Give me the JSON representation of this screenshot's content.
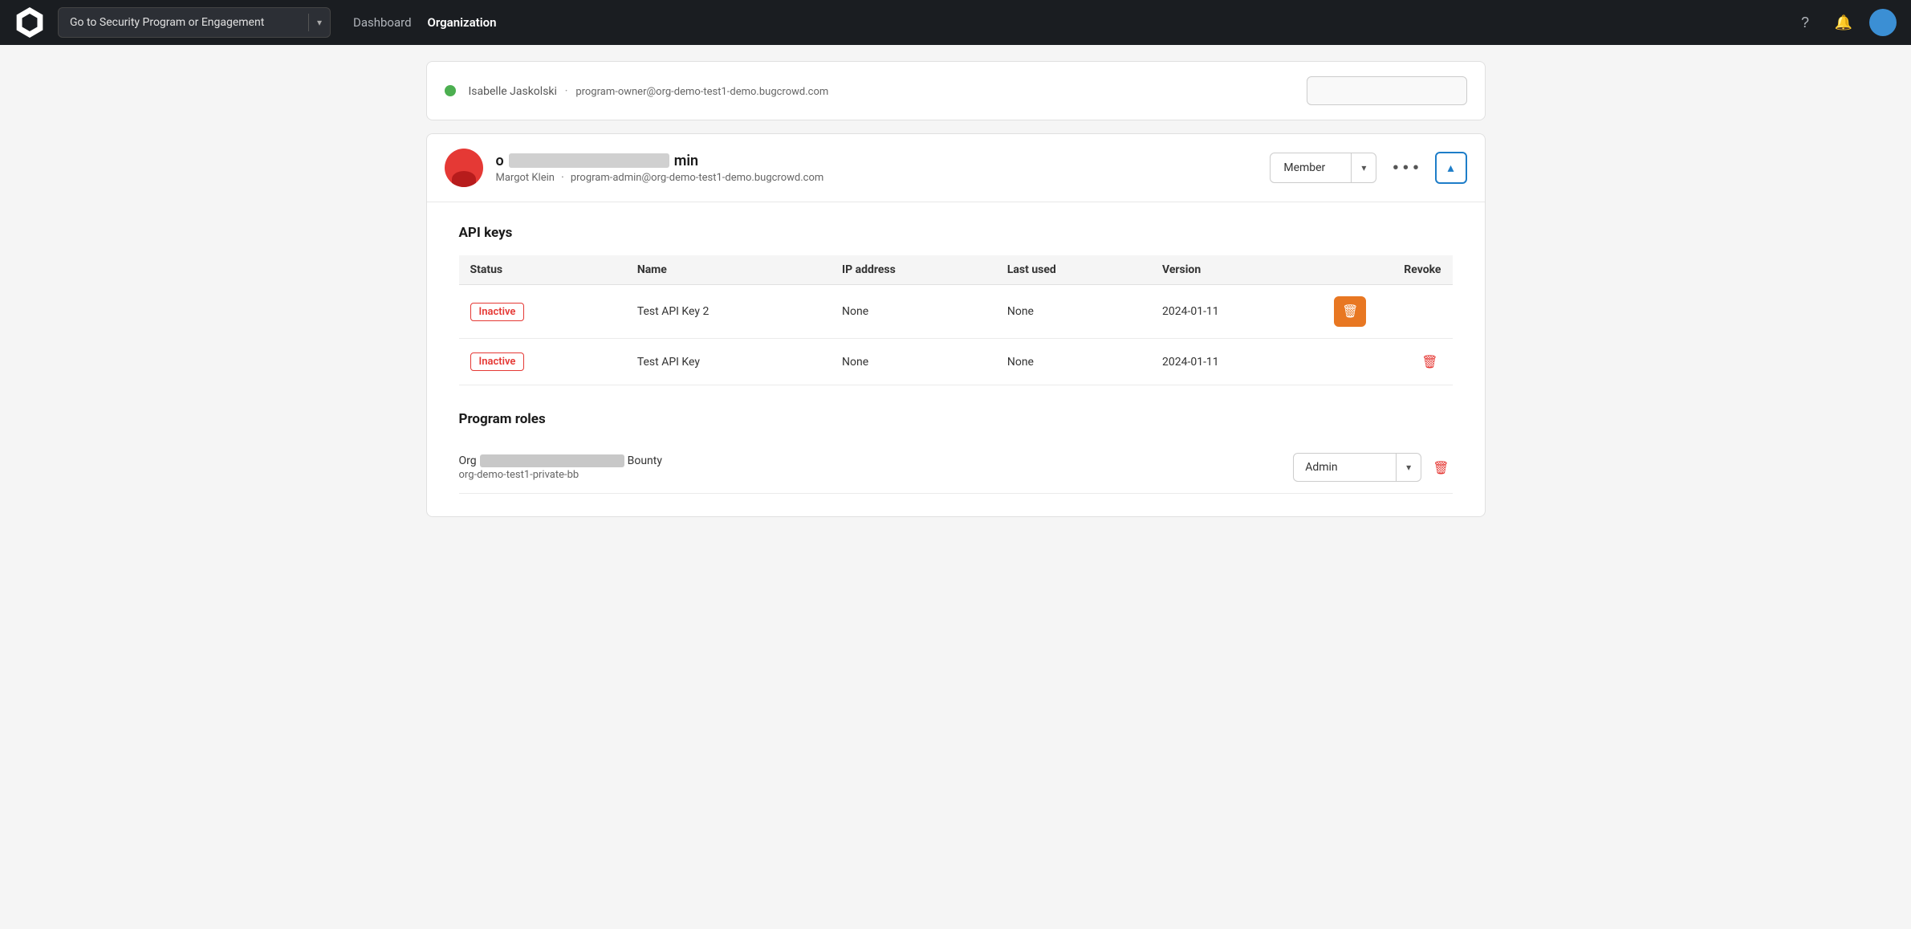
{
  "nav": {
    "dropdown_placeholder": "Go to Security Program or Engagement",
    "links": [
      {
        "label": "Dashboard",
        "active": false
      },
      {
        "label": "Organization",
        "active": true
      }
    ],
    "icons": {
      "help": "?",
      "bell": "🔔"
    }
  },
  "top_member": {
    "email": "program-owner@org-demo-test1-demo.bugcrowd.com",
    "name_prefix": "Isabelle Jaskolski",
    "dot_color": "#4caf50"
  },
  "main_member": {
    "name_prefix": "o",
    "name_suffix": "min",
    "sub_name": "Margot Klein",
    "email": "program-admin@org-demo-test1-demo.bugcrowd.com",
    "role": "Member",
    "api_keys_section": {
      "title": "API keys",
      "columns": [
        "Status",
        "Name",
        "IP address",
        "Last used",
        "Version",
        "Revoke"
      ],
      "rows": [
        {
          "status": "Inactive",
          "name": "Test API Key 2",
          "ip": "None",
          "last_used": "None",
          "version": "2024-01-11",
          "revoke_highlighted": true
        },
        {
          "status": "Inactive",
          "name": "Test API Key",
          "ip": "None",
          "last_used": "None",
          "version": "2024-01-11",
          "revoke_highlighted": false
        }
      ]
    },
    "program_roles": {
      "title": "Program roles",
      "items": [
        {
          "name_prefix": "Org",
          "name_suffix": "Bounty",
          "sub": "org-demo-test1-private-bb",
          "role": "Admin"
        }
      ]
    }
  },
  "icons": {
    "chevron_down": "▾",
    "chevron_up": "▴",
    "more": "•••",
    "trash": "🗑",
    "trash_char": "■"
  }
}
